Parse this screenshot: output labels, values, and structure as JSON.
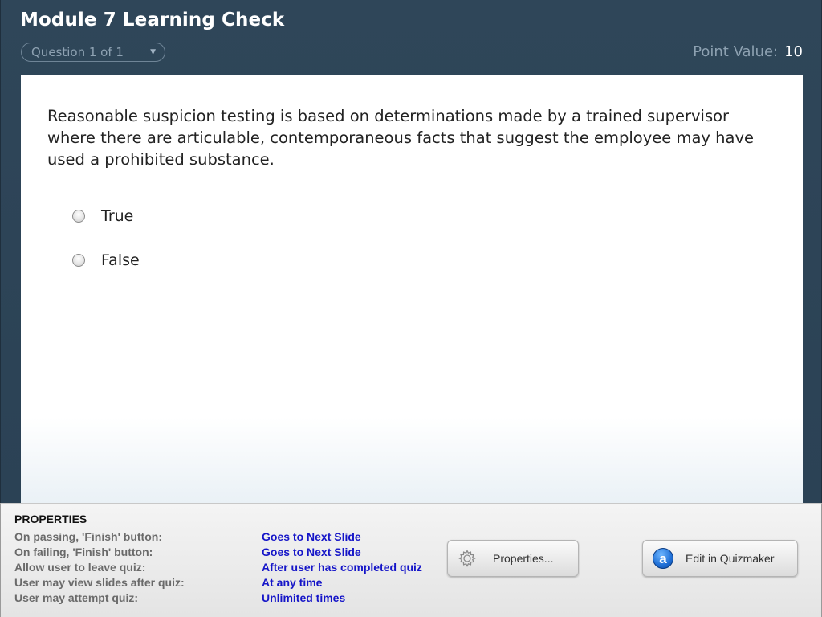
{
  "quiz": {
    "title": "Module 7 Learning Check",
    "question_selector": "Question 1 of 1",
    "point_value_label": "Point Value:",
    "point_value": "10",
    "question_text": "Reasonable suspicion testing is based on determinations made by a trained supervisor where there are articulable, contemporaneous facts that suggest the employee may have used a prohibited substance.",
    "choices": [
      {
        "label": "True",
        "selected": false
      },
      {
        "label": "False",
        "selected": false
      }
    ]
  },
  "properties": {
    "heading": "PROPERTIES",
    "rows": [
      {
        "label": "On passing, 'Finish' button:",
        "value": "Goes to Next Slide"
      },
      {
        "label": "On failing, 'Finish' button:",
        "value": "Goes to Next Slide"
      },
      {
        "label": "Allow user to leave quiz:",
        "value": "After user has completed quiz"
      },
      {
        "label": "User may view slides after quiz:",
        "value": "At any time"
      },
      {
        "label": "User may attempt quiz:",
        "value": "Unlimited times"
      }
    ],
    "properties_button": "Properties...",
    "quizmaker_button": "Edit in Quizmaker",
    "quizmaker_icon_letter": "a"
  },
  "colors": {
    "header_bg": "#2d4356",
    "value_text": "#1515c8",
    "label_text": "#6a6a6a"
  },
  "icons": {
    "question_dropdown": "chevron-down-icon",
    "properties_button": "gear-icon",
    "quizmaker_button": "quizmaker-logo-icon"
  }
}
